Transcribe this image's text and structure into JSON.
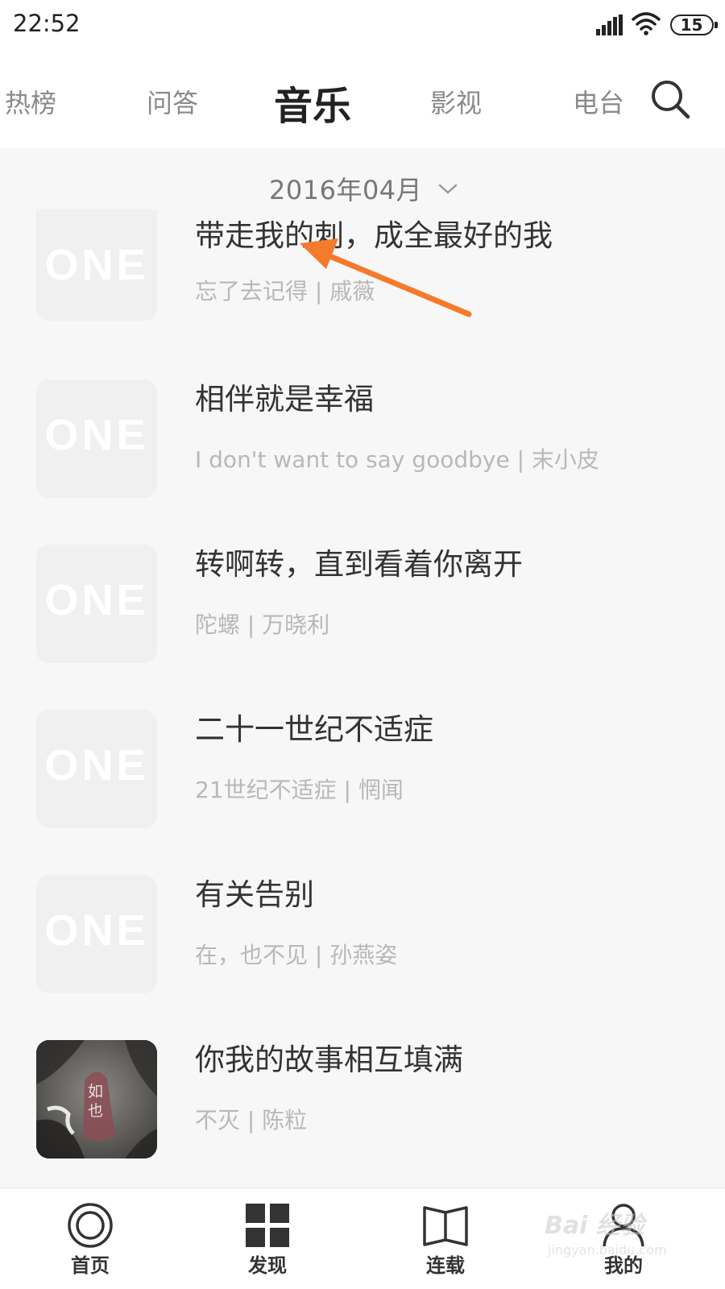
{
  "status_bar": {
    "time": "22:52",
    "battery": "15"
  },
  "tabs": [
    {
      "label": "热榜"
    },
    {
      "label": "问答"
    },
    {
      "label": "音乐",
      "active": true
    },
    {
      "label": "影视"
    },
    {
      "label": "电台"
    }
  ],
  "month_selector": {
    "label": "2016年04月"
  },
  "list": [
    {
      "title": "带走我的刺，成全最好的我",
      "subtitle": "忘了去记得 | 戚薇",
      "cover": "ONE"
    },
    {
      "title": "相伴就是幸福",
      "subtitle": "I don't want to say goodbye | 末小皮",
      "cover": "ONE"
    },
    {
      "title": "转啊转，直到看着你离开",
      "subtitle": "陀螺 | 万晓利",
      "cover": "ONE"
    },
    {
      "title": "二十一世纪不适症",
      "subtitle": "21世纪不适症 | 惘闻",
      "cover": "ONE"
    },
    {
      "title": "有关告别",
      "subtitle": "在，也不见 | 孙燕姿",
      "cover": "ONE"
    },
    {
      "title": "你我的故事相互填满",
      "subtitle": "不灭 | 陈粒",
      "cover": "如也"
    }
  ],
  "bottom_nav": [
    {
      "label": "首页",
      "icon": "home-icon"
    },
    {
      "label": "发现",
      "icon": "grid-icon"
    },
    {
      "label": "连载",
      "icon": "book-icon"
    },
    {
      "label": "我的",
      "icon": "person-icon"
    }
  ],
  "watermark": {
    "text": "Bai 经验",
    "sub": "jingyan.baidu.com"
  },
  "colors": {
    "annotation_arrow": "#f47a2c",
    "active_tab": "#222222",
    "inactive_tab": "#8a8a8a"
  }
}
